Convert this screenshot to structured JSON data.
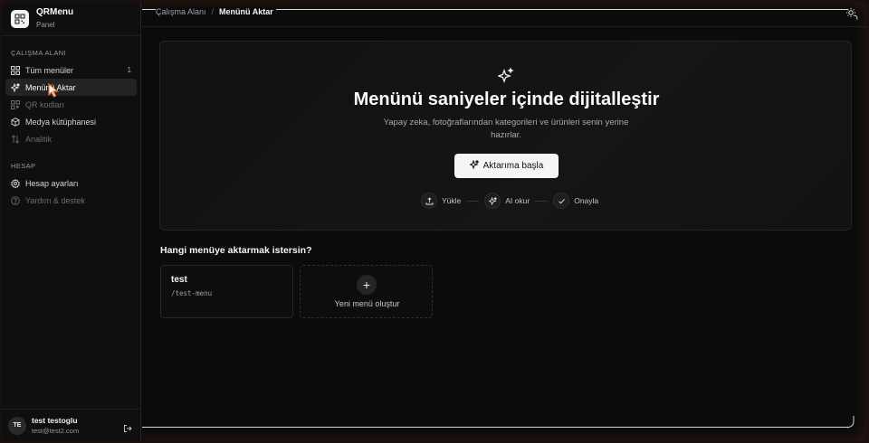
{
  "brand": {
    "title": "QRMenu",
    "subtitle": "Panel"
  },
  "sidebar": {
    "workspace_label": "ÇALIŞMA ALANI",
    "workspace_items": [
      {
        "label": "Tüm menüler",
        "icon": "grid-icon",
        "count": "1",
        "state": "normal"
      },
      {
        "label": "Menünü Aktar",
        "icon": "sparkles-icon",
        "state": "active"
      },
      {
        "label": "QR kodları",
        "icon": "qr-icon",
        "state": "dim"
      },
      {
        "label": "Medya kütüphanesi",
        "icon": "cube-icon",
        "state": "normal"
      },
      {
        "label": "Analitik",
        "icon": "sort-arrows-icon",
        "state": "dim"
      }
    ],
    "account_label": "HESAP",
    "account_items": [
      {
        "label": "Hesap ayarları",
        "icon": "gear-icon",
        "state": "normal"
      },
      {
        "label": "Yardım & destek",
        "icon": "help-circle-icon",
        "state": "dim"
      }
    ]
  },
  "user": {
    "initials": "TE",
    "name": "test testoglu",
    "email": "test@test2.com"
  },
  "header": {
    "breadcrumb_parent": "Çalışma Alanı",
    "breadcrumb_separator": "/",
    "breadcrumb_current": "Menünü Aktar"
  },
  "hero": {
    "title": "Menünü saniyeler içinde dijitalleştir",
    "description": "Yapay zeka, fotoğraflarından kategorileri ve ürünleri senin yerine hazırlar.",
    "cta_label": "Aktarıma başla",
    "steps": [
      {
        "label": "Yükle",
        "icon": "upload-icon"
      },
      {
        "label": "AI okur",
        "icon": "sparkles-icon"
      },
      {
        "label": "Onayla",
        "icon": "check-icon"
      }
    ]
  },
  "target": {
    "title": "Hangi menüye aktarmak istersin?",
    "menus": [
      {
        "name": "test",
        "slug": "/test-menu"
      }
    ],
    "new_menu_label": "Yeni menü oluştur",
    "new_menu_icon": "+"
  },
  "colors": {
    "background": "#0b0b0c",
    "accent": "#f5f5f5",
    "active_item": "#232326"
  }
}
